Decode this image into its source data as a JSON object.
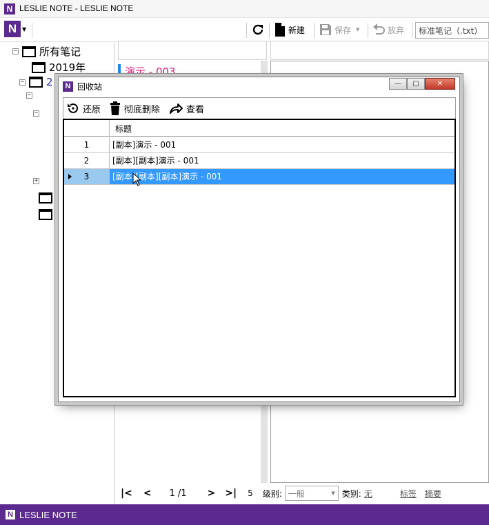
{
  "window": {
    "title": "LESLIE NOTE - LESLIE NOTE",
    "logo_letter": "N"
  },
  "toolbar": {
    "new_label": "新建",
    "save_label": "保存",
    "discard_label": "放弃",
    "note_type_value": "标准笔记（.txt）"
  },
  "tree": {
    "root_label": "所有笔记",
    "items": [
      {
        "label": "2019年"
      },
      {
        "label": "2"
      }
    ]
  },
  "note_list": {
    "items": [
      {
        "label": "演示 - 003",
        "color": "#d81b7a"
      }
    ]
  },
  "pager": {
    "page_value": "1",
    "page_total": "/1",
    "count": "5",
    "level_label": "级别:",
    "level_value": "一般",
    "category_label": "类别:",
    "category_value": "无",
    "tags_link": "标签",
    "summary_link": "摘要"
  },
  "status_bar": {
    "brand": "LESLIE NOTE",
    "color": "#5b2a8e"
  },
  "recycle_dialog": {
    "title": "回收站",
    "restore_label": "还原",
    "delete_label": "彻底删除",
    "view_label": "查看",
    "column_title": "标题",
    "rows": [
      {
        "num": "1",
        "title": "[副本]演示 - 001"
      },
      {
        "num": "2",
        "title": "[副本][副本]演示 - 001"
      },
      {
        "num": "3",
        "title": "[副本][副本][副本]演示 - 001"
      }
    ],
    "selected_index": 3,
    "selection_color": "#3399ff"
  }
}
